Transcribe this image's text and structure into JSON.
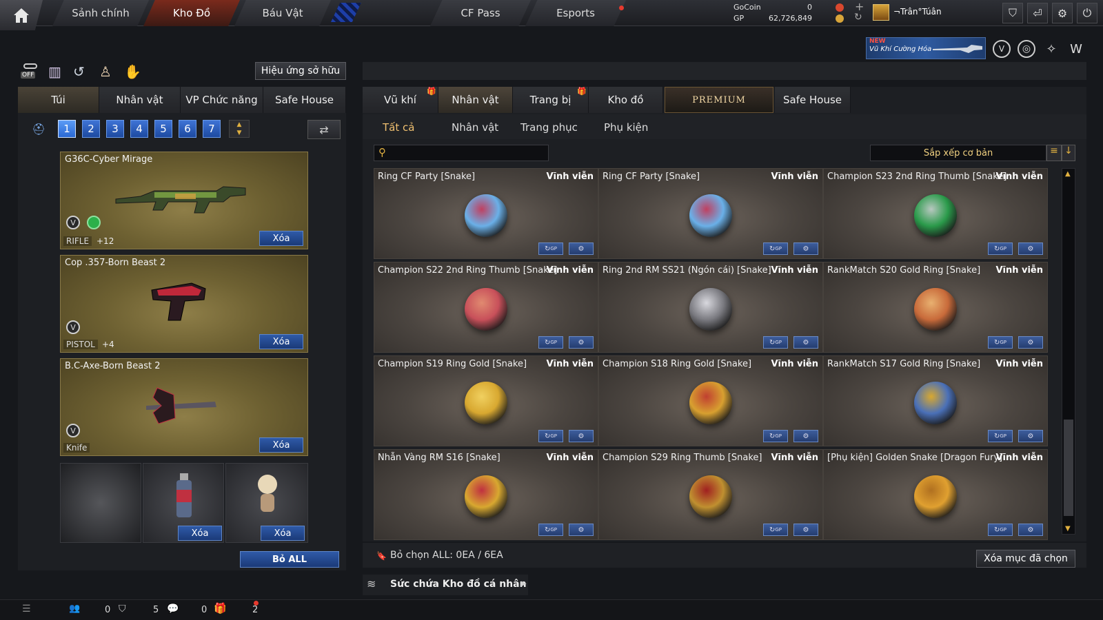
{
  "nav": {
    "tabs": [
      {
        "label": "Sảnh chính"
      },
      {
        "label": "Kho Đồ"
      },
      {
        "label": "Báu Vật"
      },
      {
        "label": "CF Pass"
      },
      {
        "label": "Esports"
      }
    ]
  },
  "currency": {
    "gocoin_label": "GoCoin",
    "gocoin_value": "0",
    "gp_label": "GP",
    "gp_value": "62,726,849"
  },
  "user": {
    "name": "¬Trân°Túân"
  },
  "banner": {
    "new": "NEW",
    "text": "Vũ Khí Cường Hóa"
  },
  "left": {
    "effect_button": "Hiệu ứng sở hữu",
    "toggle_label": "OFF",
    "tabs": [
      "Túi",
      "Nhân vật",
      "VP Chức năng",
      "Safe House"
    ],
    "slots": [
      "1",
      "2",
      "3",
      "4",
      "5",
      "6",
      "7"
    ],
    "weapons": [
      {
        "name": "G36C-Cyber Mirage",
        "type": "RIFLE",
        "level": "+12",
        "remove": "Xóa"
      },
      {
        "name": "Cop .357-Born Beast 2",
        "type": "PISTOL",
        "level": "+4",
        "remove": "Xóa"
      },
      {
        "name": "B.C-Axe-Born Beast 2",
        "type": "Knife",
        "level": "",
        "remove": "Xóa"
      }
    ],
    "small_remove_1": "Xóa",
    "small_remove_2": "Xóa",
    "remove_all": "Bỏ ALL"
  },
  "right": {
    "tabs": [
      "Vũ khí",
      "Nhân vật",
      "Trang bị",
      "Kho đồ",
      "PREMIUM",
      "Safe House"
    ],
    "subtabs": [
      "Tất cả",
      "Nhân vật",
      "Trang phục",
      "Phụ kiện"
    ],
    "search_placeholder": "",
    "sort_label": "Sắp xếp cơ bản",
    "items": [
      {
        "name": "Ring CF Party [Snake]",
        "duration": "Vĩnh viễn"
      },
      {
        "name": "Ring CF Party [Snake]",
        "duration": "Vĩnh viễn"
      },
      {
        "name": "Champion S23 2nd Ring Thumb [Snake]",
        "duration": "Vĩnh viễn"
      },
      {
        "name": "Champion S22 2nd Ring Thumb [Snake]",
        "duration": "Vĩnh viễn"
      },
      {
        "name": "Ring 2nd RM SS21 (Ngón cái) [Snake]",
        "duration": "Vĩnh viễn"
      },
      {
        "name": "RankMatch S20 Gold Ring [Snake]",
        "duration": "Vĩnh viễn"
      },
      {
        "name": "Champion S19 Ring Gold [Snake]",
        "duration": "Vĩnh viễn"
      },
      {
        "name": "Champion S18 Ring Gold [Snake]",
        "duration": "Vĩnh viễn"
      },
      {
        "name": "RankMatch S17 Gold Ring [Snake]",
        "duration": "Vĩnh viễn"
      },
      {
        "name": "Nhẫn Vàng RM S16 [Snake]",
        "duration": "Vĩnh viễn"
      },
      {
        "name": "Champion S29 Ring Thumb [Snake]",
        "duration": "Vĩnh viễn"
      },
      {
        "name": "[Phụ kiện] Golden Snake [Dragon Fury]",
        "duration": "Vĩnh viễn"
      }
    ],
    "gp_tag": "GP",
    "deselect_text": "Bỏ chọn ALL: 0EA / 6EA",
    "delete_selected": "Xóa mục đã chọn",
    "capacity_text": "Sức chứa Kho đồ cá nhân"
  },
  "bottom": {
    "friends": "0",
    "clan": "5",
    "chat": "0",
    "gifts": "2"
  },
  "colors": {
    "accent_blue": "#2a68d4",
    "gold": "#8e7e48",
    "active_red": "#7a2a1c"
  }
}
